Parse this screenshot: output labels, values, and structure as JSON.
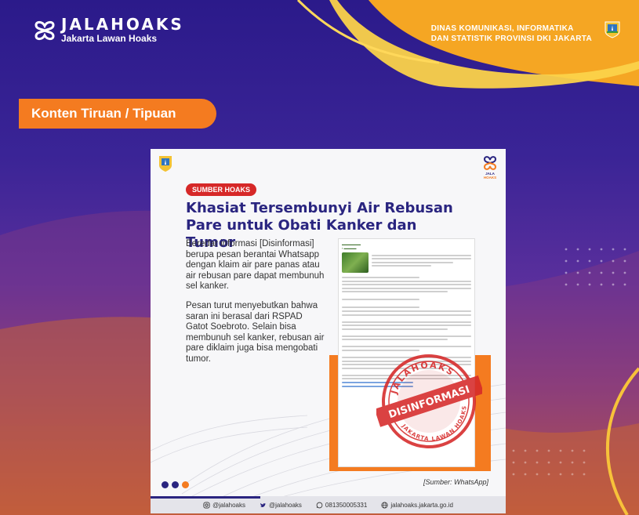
{
  "brand": {
    "name": "JALAHOAKS",
    "tagline": "Jakarta Lawan Hoaks"
  },
  "agency": {
    "line1": "DINAS KOMUNIKASI, INFORMATIKA",
    "line2": "DAN STATISTIK PROVINSI DKI JAKARTA"
  },
  "category_label": "Konten Tiruan / Tipuan",
  "card": {
    "badge": "SUMBER HOAKS",
    "headline": "Khasiat Tersembunyi Air Rebusan Pare untuk Obati Kanker dan Tumor",
    "paragraph1": "Beredar informasi [Disinformasi] berupa pesan berantai Whatsapp dengan klaim air pare panas atau air rebusan pare dapat membunuh sel kanker.",
    "paragraph2": "Pesan turut menyebutkan bahwa saran ini berasal dari RSPAD Gatot Soebroto. Selain bisa membunuh sel kanker, rebusan air pare diklaim juga bisa mengobati tumor.",
    "source": "[Sumber: WhatsApp]",
    "stamp_top": "JALAHOAKS",
    "stamp_middle": "DISINFORMASI",
    "stamp_bottom": "JAKARTA LAWAN HOAKS",
    "jh_logo_text": "JALA HOAKS"
  },
  "footer": {
    "instagram": "@jalahoaks",
    "twitter": "@jalahoaks",
    "whatsapp": "081350005331",
    "website": "jalahoaks.jakarta.go.id"
  },
  "colors": {
    "accent_orange": "#f47b20",
    "navy": "#2a2580",
    "stamp_red": "#d62828",
    "dot_blue": "#2a2580",
    "dot_orange": "#f47b20"
  }
}
